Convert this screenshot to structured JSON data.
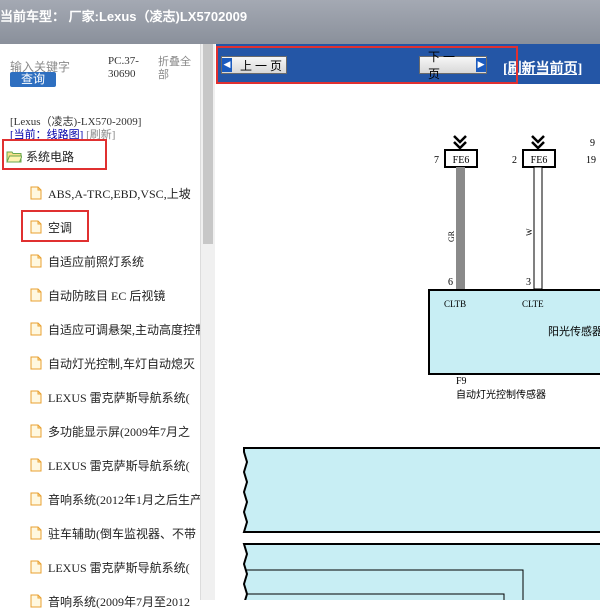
{
  "window": {
    "title": "当前车型：  厂家:Lexus（凌志)LX5702009"
  },
  "search": {
    "placeholder": "输入关键字",
    "button": "查询",
    "pc_code": "PC.37-30690",
    "fold_all": "折叠全部"
  },
  "car_info": {
    "model": "[Lexus（凌志)-LX570-2009]",
    "current_prefix": "[当前：",
    "current_link": "线路图",
    "current_suffix": "]",
    "refresh": "[刷新]"
  },
  "tree": {
    "root": "系统电路",
    "items": [
      "ABS,A-TRC,EBD,VSC,上坡",
      "空调",
      "自适应前照灯系统",
      "自动防眩目 EC 后视镜",
      "自适应可调悬架,主动高度控制",
      "自动灯光控制,车灯自动熄灭",
      "LEXUS 雷克萨斯导航系统(",
      "多功能显示屏(2009年7月之",
      "LEXUS 雷克萨斯导航系统(",
      "音响系统(2012年1月之后生产",
      "驻车辅助(倒车监视器、不带",
      "LEXUS 雷克萨斯导航系统(",
      "音响系统(2009年7月至2012"
    ]
  },
  "nav": {
    "prev": "上一页",
    "next": "下一页",
    "refresh_current": "[刷新当前页]"
  },
  "diagram": {
    "connector_left": {
      "pin": "7",
      "name": "FE6"
    },
    "connector_right": {
      "pin": "2",
      "name": "FE6"
    },
    "extra_pins": [
      "9",
      "19"
    ],
    "wire_left_color": "GR",
    "wire_right_color": "W",
    "pin_left": "6",
    "pin_right": "3",
    "terminal_left": "CLTB",
    "terminal_right": "CLTE",
    "sensor_label": "阳光传感器",
    "component_code": "F9",
    "component_name": "自动灯光控制传感器"
  },
  "colors": {
    "accent_blue": "#2456a6",
    "highlight_red": "#e03030",
    "component_fill": "#c8eef4"
  }
}
